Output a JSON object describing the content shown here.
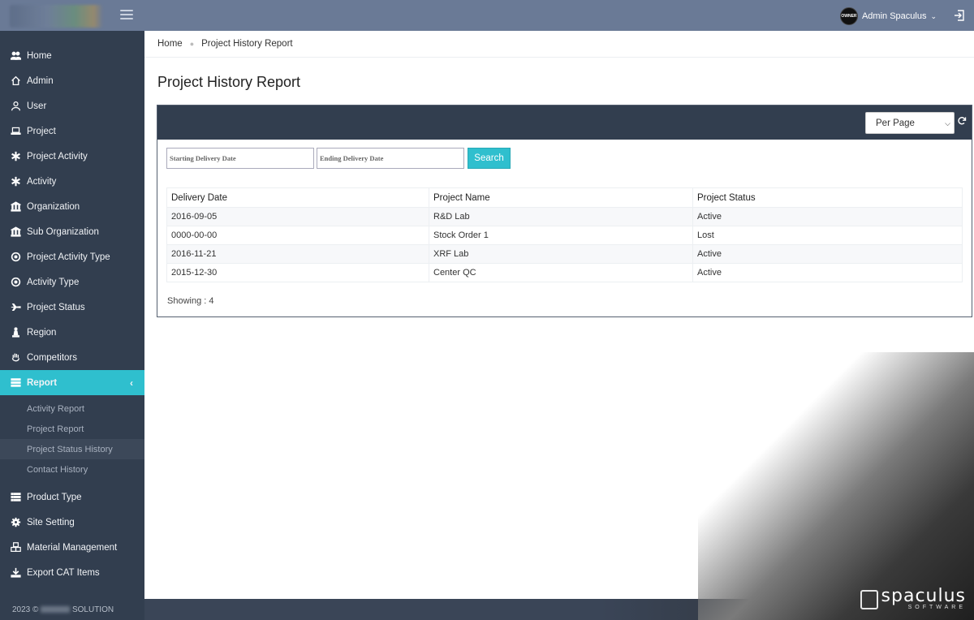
{
  "header": {
    "user_name": "Admin Spaculus",
    "avatar_text": "OWNER"
  },
  "sidebar": {
    "items": [
      {
        "label": "Home",
        "icon": "users-icon"
      },
      {
        "label": "Admin",
        "icon": "home-icon"
      },
      {
        "label": "User",
        "icon": "user-icon"
      },
      {
        "label": "Project",
        "icon": "laptop-icon"
      },
      {
        "label": "Project Activity",
        "icon": "asterisk-icon"
      },
      {
        "label": "Activity",
        "icon": "asterisk-icon"
      },
      {
        "label": "Organization",
        "icon": "bank-icon"
      },
      {
        "label": "Sub Organization",
        "icon": "bank-icon"
      },
      {
        "label": "Project Activity Type",
        "icon": "target-icon"
      },
      {
        "label": "Activity Type",
        "icon": "target-icon"
      },
      {
        "label": "Project Status",
        "icon": "plane-icon"
      },
      {
        "label": "Region",
        "icon": "pawn-icon"
      },
      {
        "label": "Competitors",
        "icon": "hand-icon"
      },
      {
        "label": "Report",
        "icon": "list-icon"
      }
    ],
    "report_sub": [
      "Activity Report",
      "Project Report",
      "Project Status History",
      "Contact History"
    ],
    "items_after": [
      {
        "label": "Product Type",
        "icon": "list-alt-icon"
      },
      {
        "label": "Site Setting",
        "icon": "gear-icon"
      },
      {
        "label": "Material Management",
        "icon": "cubes-icon"
      },
      {
        "label": "Export CAT Items",
        "icon": "download-icon"
      }
    ],
    "footer_prefix": "2023 ©",
    "footer_suffix": "SOLUTION"
  },
  "breadcrumb": {
    "home": "Home",
    "current": "Project History Report"
  },
  "page_title": "Project History Report",
  "panel": {
    "per_page": "Per Page",
    "start_placeholder": "Starting Delivery Date",
    "end_placeholder": "Ending Delivery Date",
    "search_label": "Search",
    "columns": [
      "Delivery Date",
      "Project Name",
      "Project Status"
    ],
    "rows": [
      [
        "2016-09-05",
        "R&D Lab",
        "Active"
      ],
      [
        "0000-00-00",
        "Stock Order 1",
        "Lost"
      ],
      [
        "2016-11-21",
        "XRF Lab",
        "Active"
      ],
      [
        "2015-12-30",
        "Center QC",
        "Active"
      ]
    ],
    "showing": "Showing : 4"
  },
  "watermark": {
    "name": "spaculus",
    "sub": "SOFTWARE"
  },
  "colors": {
    "topbar": "#6a7a96",
    "sidebar": "#323e4f",
    "accent": "#2fbfce"
  }
}
